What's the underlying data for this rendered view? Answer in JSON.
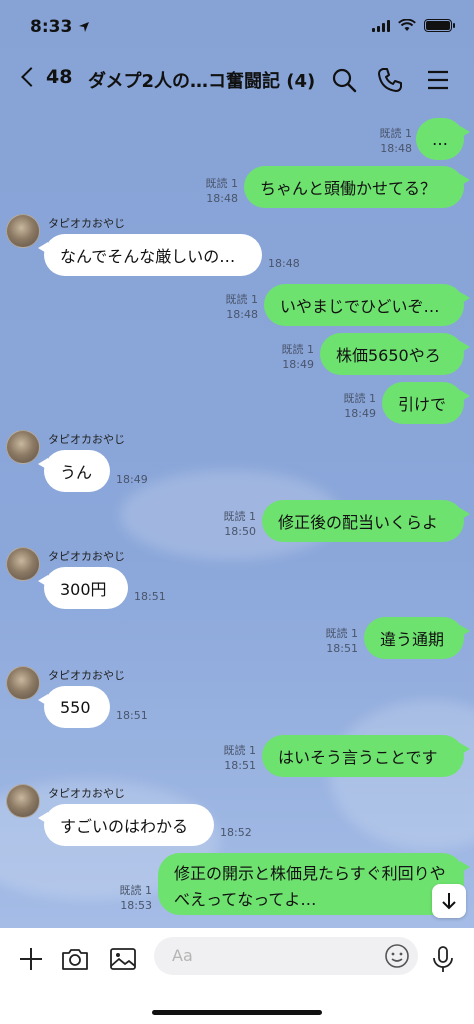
{
  "status_bar": {
    "time": "8:33"
  },
  "header": {
    "back_count": "48",
    "title": "ダメプ2人の…コ奮闘記 (4)"
  },
  "icons": {
    "back": "chevron-left-icon",
    "search": "search-icon",
    "call": "phone-icon",
    "menu": "menu-icon",
    "add": "plus-icon",
    "camera": "camera-icon",
    "image": "image-icon",
    "emoji": "emoji-icon",
    "mic": "mic-icon",
    "scroll": "arrow-down-icon"
  },
  "colors": {
    "outgoing": "#6ee26f",
    "incoming": "#ffffff",
    "background": "#8aa5d8"
  },
  "messages": [
    {
      "dir": "out",
      "text": "…",
      "read": "既読 1",
      "time": "18:48"
    },
    {
      "dir": "out",
      "text": "ちゃんと頭働かせてる？",
      "read": "既読 1",
      "time": "18:48"
    },
    {
      "dir": "in",
      "sender": "タピオカおやじ",
      "text": "なんでそんな厳しいの…",
      "time": "18:48"
    },
    {
      "dir": "out",
      "text": "いやまじでひどいぞ…",
      "read": "既読 1",
      "time": "18:48"
    },
    {
      "dir": "out",
      "text": "株価5650やろ",
      "read": "既読 1",
      "time": "18:49"
    },
    {
      "dir": "out",
      "text": "引けで",
      "read": "既読 1",
      "time": "18:49"
    },
    {
      "dir": "in",
      "sender": "タピオカおやじ",
      "text": "うん",
      "time": "18:49"
    },
    {
      "dir": "out",
      "text": "修正後の配当いくらよ",
      "read": "既読 1",
      "time": "18:50"
    },
    {
      "dir": "in",
      "sender": "タピオカおやじ",
      "text": "300円",
      "time": "18:51"
    },
    {
      "dir": "out",
      "text": "違う通期",
      "read": "既読 1",
      "time": "18:51"
    },
    {
      "dir": "in",
      "sender": "タピオカおやじ",
      "text": "550",
      "time": "18:51"
    },
    {
      "dir": "out",
      "text": "はいそう言うことです",
      "read": "既読 1",
      "time": "18:51"
    },
    {
      "dir": "in",
      "sender": "タピオカおやじ",
      "text": "すごいのはわかる",
      "time": "18:52"
    },
    {
      "dir": "out",
      "text": "修正の開示と株価見たらすぐ利回りやべえってなってよ…",
      "read": "既読 1",
      "time": "18:53"
    }
  ],
  "input": {
    "placeholder": "Aa"
  }
}
